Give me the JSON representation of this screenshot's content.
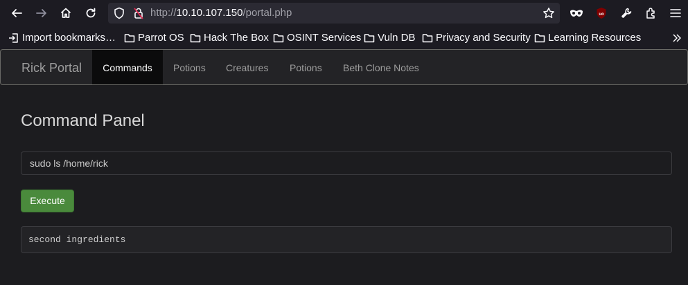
{
  "browser": {
    "url_scheme": "http://",
    "url_host": "10.10.107.150",
    "url_path": "/portal.php"
  },
  "bookmarks": [
    {
      "label": "Import bookmarks…",
      "icon": "import-icon"
    },
    {
      "label": "Parrot OS",
      "icon": "folder-icon"
    },
    {
      "label": "Hack The Box",
      "icon": "folder-icon"
    },
    {
      "label": "OSINT Services",
      "icon": "folder-icon"
    },
    {
      "label": "Vuln DB",
      "icon": "folder-icon"
    },
    {
      "label": "Privacy and Security",
      "icon": "folder-icon"
    },
    {
      "label": "Learning Resources",
      "icon": "folder-icon"
    }
  ],
  "nav": {
    "brand": "Rick Portal",
    "items": [
      {
        "label": "Commands",
        "active": true
      },
      {
        "label": "Potions",
        "active": false
      },
      {
        "label": "Creatures",
        "active": false
      },
      {
        "label": "Potions",
        "active": false
      },
      {
        "label": "Beth Clone Notes",
        "active": false
      }
    ]
  },
  "main": {
    "title": "Command Panel",
    "command_value": "sudo ls /home/rick",
    "execute_label": "Execute",
    "output": "second ingredients"
  },
  "colors": {
    "accent_button": "#4a8a3c",
    "active_nav_bg": "#0b0b0c",
    "page_bg": "#1c1c1f"
  }
}
